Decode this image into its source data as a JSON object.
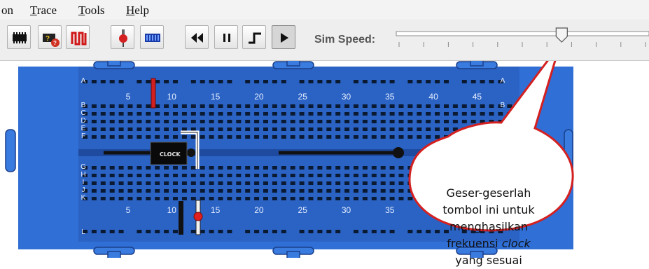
{
  "menu": {
    "items": [
      {
        "label": "on",
        "underline": ""
      },
      {
        "label": "Trace",
        "underline": "T"
      },
      {
        "label": "Tools",
        "underline": "T"
      },
      {
        "label": "Help",
        "underline": "H"
      }
    ]
  },
  "toolbar": {
    "buttons": [
      {
        "name": "chip-tool-icon"
      },
      {
        "name": "chip-help-icon"
      },
      {
        "name": "wire-tool-icon"
      },
      {
        "name": "probe-tool-icon"
      },
      {
        "name": "led-bar-icon"
      },
      {
        "name": "rewind-icon"
      },
      {
        "name": "pause-icon"
      },
      {
        "name": "clock-step-icon"
      },
      {
        "name": "play-icon"
      }
    ],
    "sim_speed_label": "Sim Speed:",
    "sim_speed_level": 0.66
  },
  "breadboard": {
    "row_labels_top": [
      "A",
      "B",
      "C",
      "D",
      "E",
      "F"
    ],
    "row_labels_bottom": [
      "G",
      "H",
      "I",
      "J",
      "K",
      "L"
    ],
    "column_numbers_top": [
      "5",
      "10",
      "15",
      "20",
      "25",
      "30",
      "35",
      "40",
      "45"
    ],
    "column_numbers_bottom": [
      "5",
      "10",
      "15",
      "20",
      "25",
      "30",
      "35"
    ],
    "chip_label": "CLOCK",
    "colors": {
      "board": "#2f6fd6",
      "hole": "#0b1a33",
      "led_red": "#e02020",
      "wire_red": "#d22020",
      "wire_white": "#ffffff"
    }
  },
  "callout": {
    "line1": "Geser-geserlah",
    "line2": "tombol ini untuk",
    "line3": "menghasilkan",
    "line4_prefix": "frekuensi ",
    "line4_italic": "clock",
    "line5": "yang sesuai",
    "border_color": "#d42020"
  }
}
